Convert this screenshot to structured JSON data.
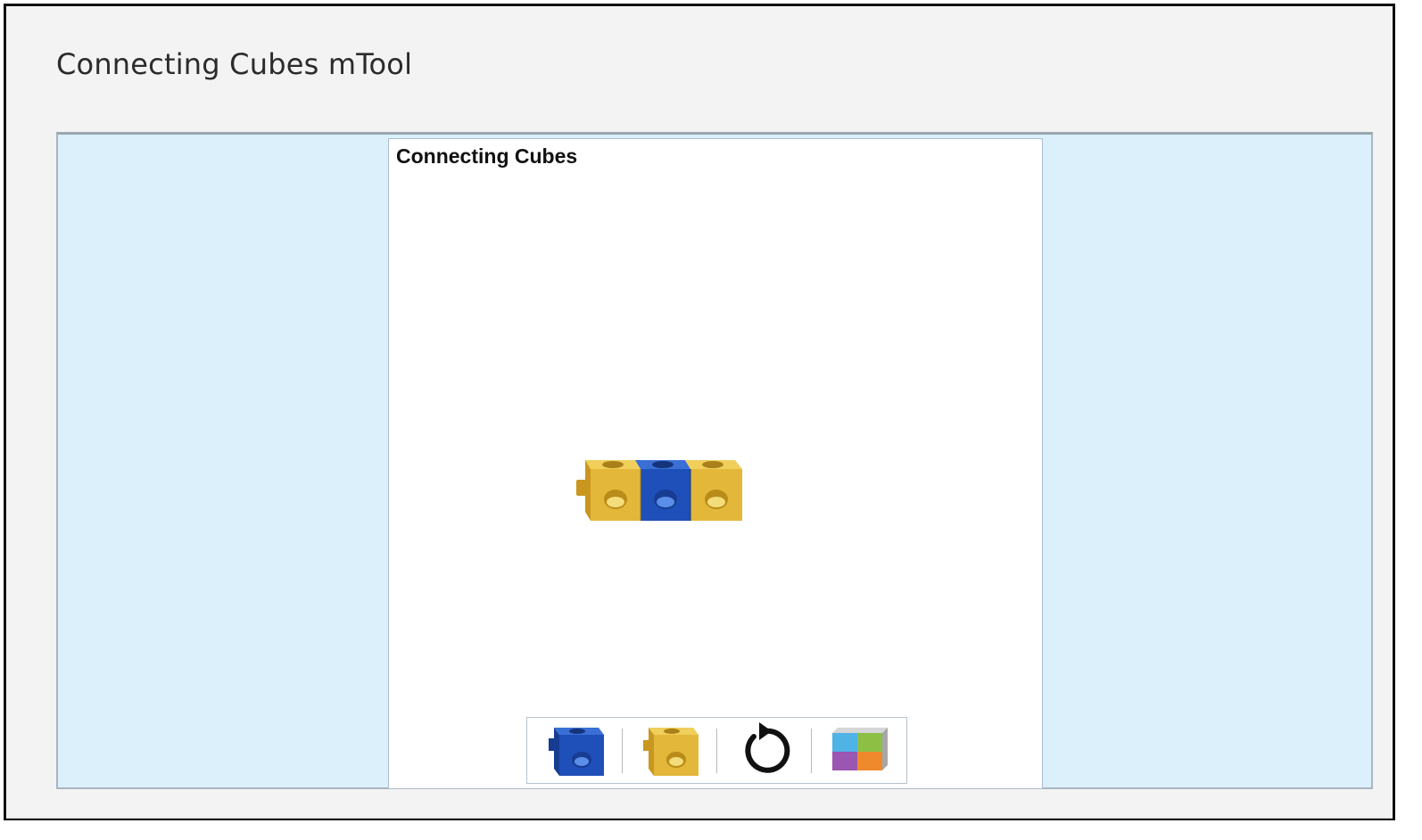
{
  "page": {
    "title": "Connecting Cubes mTool"
  },
  "tool": {
    "title": "Connecting Cubes",
    "train": [
      {
        "color": "yellow"
      },
      {
        "color": "blue"
      },
      {
        "color": "yellow"
      }
    ],
    "toolbar": [
      {
        "icon": "blue-cube-icon"
      },
      {
        "icon": "yellow-cube-icon"
      },
      {
        "icon": "reset-icon"
      },
      {
        "icon": "color-palette-icon"
      }
    ]
  },
  "colors": {
    "blue": "#1f4fb8",
    "yellow": "#e3b73a",
    "stage_bg": "#dcf0fb"
  }
}
